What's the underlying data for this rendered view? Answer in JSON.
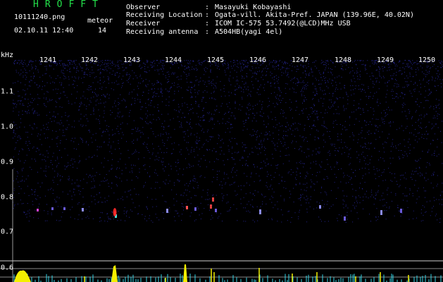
{
  "header": {
    "app_title": "HROFFT",
    "filename": "10111240.png",
    "datetime": "02.10.11 12:40",
    "meteor_label": "meteor",
    "meteor_count": "14"
  },
  "info": [
    {
      "label": "Observer",
      "value": "Masayuki Kobayashi"
    },
    {
      "label": "Receiving Location",
      "value": "Ogata-vill. Akita-Pref. JAPAN (139.96E, 40.02N)"
    },
    {
      "label": "Receiver",
      "value": "ICOM IC-575 53.7492(@LCD)MHz USB"
    },
    {
      "label": "Receiving antenna",
      "value": "A504HB(yagi 4el)"
    }
  ],
  "separator": ":",
  "axis": {
    "y_unit": "kHz",
    "x_ticks": [
      "1241",
      "1242",
      "1243",
      "1244",
      "1245",
      "1246",
      "1247",
      "1248",
      "1249",
      "1250"
    ],
    "y_ticks": [
      "1.1",
      "1.0",
      "0.9",
      "0.8",
      "0.7",
      "0.6"
    ]
  },
  "colors": {
    "title": "#23e04a",
    "noise": "#2a2aa8",
    "trace_top": "#d0d0d0",
    "spike_yellow": "#f4f000",
    "spike_cyan": "#33d6e8"
  }
}
